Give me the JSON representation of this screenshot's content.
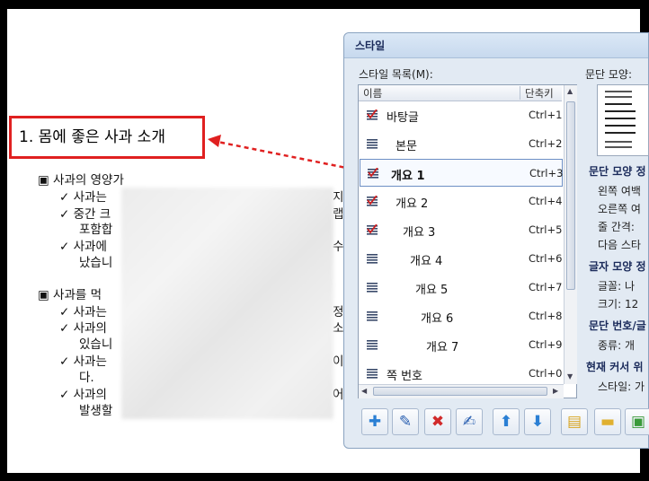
{
  "document": {
    "title": "1. 몸에 좋은 사과 소개",
    "lines": [
      "▣  사과의 영양가",
      "✓  사과는",
      "✓  중간 크",
      "포함합",
      "✓  사과에",
      "났습니",
      "▣  사과를 먹",
      "✓   사과는",
      "✓   사과의",
      "있습니",
      "✓   사과는",
      "다.",
      "✓   사과의",
      "발생할"
    ],
    "right_fragments": [
      "지",
      "랩",
      "수",
      "정",
      "소",
      "이",
      "어"
    ]
  },
  "dialog": {
    "title": "스타일",
    "list_label": "스타일 목록(M):",
    "preview_label": "문단 모양:",
    "columns": {
      "name": "이름",
      "shortcut": "단축키"
    },
    "styles": [
      {
        "name": "바탕글",
        "shortcut": "Ctrl+1",
        "icon": "paragraph-check-icon"
      },
      {
        "name": "본문",
        "shortcut": "Ctrl+2",
        "icon": "paragraph-icon"
      },
      {
        "name": "개요 1",
        "shortcut": "Ctrl+3",
        "icon": "paragraph-check-icon"
      },
      {
        "name": "개요 2",
        "shortcut": "Ctrl+4",
        "icon": "paragraph-check-icon"
      },
      {
        "name": "개요 3",
        "shortcut": "Ctrl+5",
        "icon": "paragraph-check-icon"
      },
      {
        "name": "개요 4",
        "shortcut": "Ctrl+6",
        "icon": "paragraph-icon"
      },
      {
        "name": "개요 5",
        "shortcut": "Ctrl+7",
        "icon": "paragraph-icon"
      },
      {
        "name": "개요 6",
        "shortcut": "Ctrl+8",
        "icon": "paragraph-icon"
      },
      {
        "name": "개요 7",
        "shortcut": "Ctrl+9",
        "icon": "paragraph-icon"
      },
      {
        "name": "쪽 번호",
        "shortcut": "Ctrl+0",
        "icon": "paragraph-icon"
      }
    ],
    "selected_style": "개요 1",
    "side_info": [
      "문단 모양 정",
      "왼쪽 여백",
      "오른쪽 여",
      "줄 간격:",
      "다음 스타",
      "글자 모양 정",
      "글꼴: 나",
      "크기: 12",
      "문단 번호/글",
      "종류: 개",
      "현재 커서 위",
      "스타일: 가"
    ],
    "toolbar": [
      {
        "name": "add-style-button",
        "icon": "plus-icon",
        "glyph": "✚",
        "color": "#2a7fd4"
      },
      {
        "name": "edit-style-button",
        "icon": "pencil-icon",
        "glyph": "✎",
        "color": "#2a5fb0"
      },
      {
        "name": "delete-style-button",
        "icon": "x-icon",
        "glyph": "✖",
        "color": "#d12a2a"
      },
      {
        "name": "rename-style-button",
        "icon": "edit-text-icon",
        "glyph": "✍",
        "color": "#2a5fb0"
      },
      {
        "name": "move-up-button",
        "icon": "arrow-up-icon",
        "glyph": "⬆",
        "color": "#2a7fd4"
      },
      {
        "name": "move-down-button",
        "icon": "arrow-down-icon",
        "glyph": "⬇",
        "color": "#2a7fd4"
      },
      {
        "name": "import-button",
        "icon": "folder-export-icon",
        "glyph": "▤",
        "color": "#d8a420"
      },
      {
        "name": "open-button",
        "icon": "folder-icon",
        "glyph": "▬",
        "color": "#e0b030"
      },
      {
        "name": "save-button",
        "icon": "save-icon",
        "glyph": "▣",
        "color": "#3a9a3a"
      }
    ]
  },
  "colors": {
    "highlight_red": "#e02020",
    "dialog_bg": "#e2eaf3"
  }
}
